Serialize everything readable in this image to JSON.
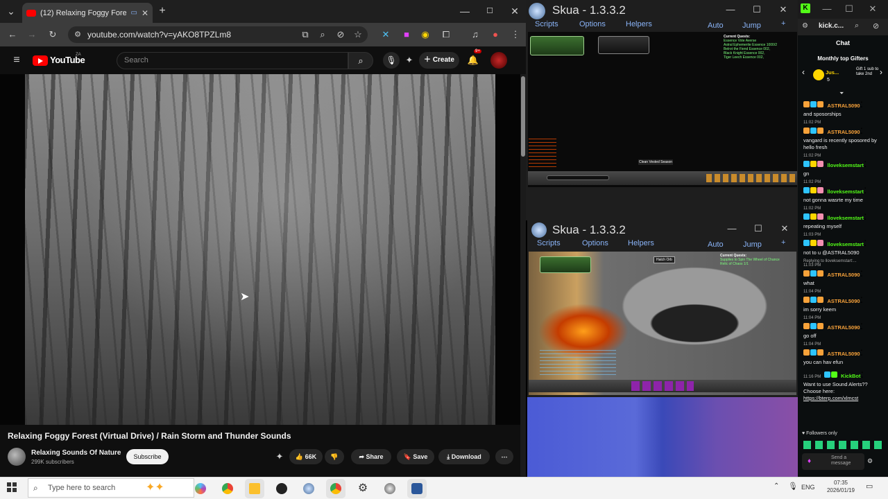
{
  "browser": {
    "tab_title": "(12) Relaxing Foggy Forest",
    "url": "youtube.com/watch?v=yAKO8TPZLm8",
    "new_tab_label": "+"
  },
  "youtube": {
    "brand": "YouTube",
    "brand_badge": "ZA",
    "search_placeholder": "Search",
    "create_label": "Create",
    "notifications_count": "9+",
    "video_title": "Relaxing Foggy Forest (Virtual Drive) / Rain Storm and Thunder Sounds",
    "channel_name": "Relaxing Sounds Of Nature",
    "channel_subs": "299K subscribers",
    "subscribe_label": "Subscribe",
    "like_count": "66K",
    "share_label": "Share",
    "save_label": "Save",
    "download_label": "Download"
  },
  "skua_top": {
    "title": "Skua - 1.3.3.2",
    "menu": [
      "Scripts",
      "Options",
      "Helpers"
    ],
    "right_menu": [
      "Auto",
      "Jump"
    ],
    "quest_header": "Current Quests:",
    "quest_lines": [
      "Essence Vote Averse",
      "Astral Ephemerite Essence 1000/2",
      "Belrot the Fiend Essence 002,",
      "Black Knight Essence 002,",
      "Tiger Leech Essence 002,"
    ],
    "game_label": "Clean Vested Season"
  },
  "skua_bottom": {
    "title": "Skua - 1.3.3.2",
    "menu": [
      "Scripts",
      "Options",
      "Helpers"
    ],
    "right_menu": [
      "Auto",
      "Jump"
    ],
    "quest_header": "Current Quests:",
    "quest_lines": [
      "Supplies to Spin The Wheel of Chance",
      "Relic of Chaos 1/1"
    ],
    "target_label": "Hatch Orb"
  },
  "kick": {
    "tab_label": "kick.c...",
    "chat_header": "Chat",
    "gifters_header": "Monthly top Gifters",
    "gifter_name": "Jus...",
    "gifter_count": "5",
    "gift_cta": "Gift 1 sub to take 2nd",
    "messages": [
      {
        "time": "",
        "user": "ASTRAL5090",
        "text": "and sposorships"
      },
      {
        "time": "11:02 PM",
        "user": "ASTRAL5090",
        "text": "vangard is recently sposored by hello fresh"
      },
      {
        "time": "11:02 PM",
        "user": "lloveksemstart",
        "text": "gn"
      },
      {
        "time": "11:02 PM",
        "user": "lloveksemstart",
        "text": "not gonna wasrte my time"
      },
      {
        "time": "11:02 PM",
        "user": "lloveksemstart",
        "text": "repeating myself"
      },
      {
        "time": "11:03 PM",
        "user": "lloveksemstart",
        "text": "not to u @ASTRAL5090"
      },
      {
        "time": "11:03 PM",
        "user": "ASTRAL5090",
        "text": "what",
        "reply": "Replying to lloveksemstart:..."
      },
      {
        "time": "11:04 PM",
        "user": "ASTRAL5090",
        "text": "im sorry keem"
      },
      {
        "time": "11:04 PM",
        "user": "ASTRAL5090",
        "text": "go off"
      },
      {
        "time": "11:04 PM",
        "user": "ASTRAL5090",
        "text": "you can hav efun"
      },
      {
        "time": "11:16 PM",
        "user": "KickBot",
        "text": "Want to use Sound Alerts?? Choose here:",
        "link": "https://bterp.com/xlmcst"
      }
    ],
    "followers_only": "Followers only",
    "send_placeholder": "Send a message"
  },
  "taskbar": {
    "search_placeholder": "Type here to search",
    "language": "ENG",
    "time": "07:35",
    "date": "2026/01/19"
  },
  "colors": {
    "youtube_red": "#ff0000",
    "kick_green": "#53fc18",
    "skua_menu_blue": "#8ab4f8"
  }
}
